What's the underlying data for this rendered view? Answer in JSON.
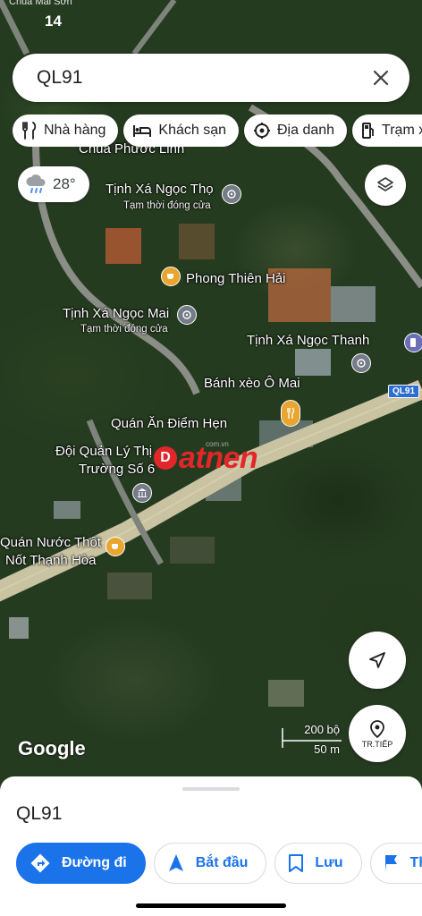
{
  "status": {
    "time": "14",
    "top_text": "Chùa Mai Sơn"
  },
  "search": {
    "query": "QL91"
  },
  "chips": [
    {
      "icon": "restaurant-icon",
      "label": "Nhà hàng"
    },
    {
      "icon": "hotel-icon",
      "label": "Khách sạn"
    },
    {
      "icon": "landmark-icon",
      "label": "Địa danh"
    },
    {
      "icon": "gas-station-icon",
      "label": "Trạm xăng"
    }
  ],
  "weather": {
    "temperature": "28°",
    "icon": "rain-cloud-icon"
  },
  "map_labels": {
    "chua_phuoc_linh": "Chùa Phước Linh",
    "tinh_xa_ngoc_tho": "Tịnh Xá Ngọc Thọ",
    "tinh_xa_ngoc_tho_status": "Tạm thời đóng cửa",
    "phong_thien_hai": "Phong Thiên Hải",
    "tinh_xa_ngoc_mai": "Tịnh Xá Ngọc Mai",
    "tinh_xa_ngoc_mai_status": "Tạm thời đóng cửa",
    "tinh_xa_ngoc_thanh": "Tịnh Xá Ngọc Thanh",
    "banh_xeo": "Bánh xèo Ô Mai",
    "route_shield": "QL91",
    "quan_an": "Quán Ăn Điểm Hẹn",
    "doi_quan_ly_1": "Đội Quản Lý Thị",
    "doi_quan_ly_2": "Trường Số 6",
    "quan_nuoc_1": "Quán Nước Thốt",
    "quan_nuoc_2": "Nốt Thạnh Hòa"
  },
  "watermark": {
    "text": "atnen",
    "letter": "D",
    "small": "com.vn"
  },
  "attribution": "Google",
  "scale": {
    "imperial": "200 bộ",
    "metric": "50 m"
  },
  "directions_fab_label": "TR.TIẾP",
  "sheet": {
    "title": "QL91",
    "actions": [
      {
        "icon": "directions-icon",
        "label": "Đường đi"
      },
      {
        "icon": "navigation-arrow-icon",
        "label": "Bắt đầu"
      },
      {
        "icon": "bookmark-icon",
        "label": "Lưu"
      },
      {
        "icon": "flag-icon",
        "label": "Thêm nhãn"
      }
    ]
  },
  "colors": {
    "accent": "#1a73e8",
    "watermark_red": "#e3262a",
    "road": "#c9c3a2"
  }
}
